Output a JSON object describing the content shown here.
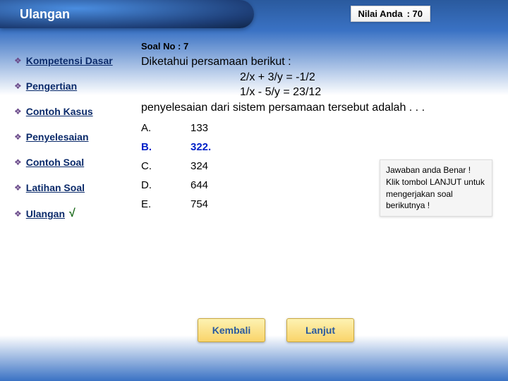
{
  "header": {
    "title": "Ulangan",
    "score_label": "Nilai Anda",
    "score_value": ": 70"
  },
  "sidebar": {
    "items": [
      {
        "label": "Kompetensi Dasar",
        "active": false
      },
      {
        "label": "Pengertian",
        "active": false
      },
      {
        "label": "Contoh Kasus",
        "active": false
      },
      {
        "label": "Penyelesaian",
        "active": false
      },
      {
        "label": "Contoh Soal",
        "active": false
      },
      {
        "label": "Latihan Soal",
        "active": false
      },
      {
        "label": "Ulangan",
        "active": true
      }
    ]
  },
  "main": {
    "soal_no": "Soal No : 7",
    "question_line1": "Diketahui persamaan berikut :",
    "question_eq1": "2/x + 3/y = -1/2",
    "question_eq2": "1/x - 5/y  = 23/12",
    "question_line2": "penyelesaian dari sistem persamaan tersebut adalah . . .",
    "options": [
      {
        "letter": "A.",
        "text": "133",
        "selected": false
      },
      {
        "letter": "B.",
        "text": "322.",
        "selected": true
      },
      {
        "letter": "C.",
        "text": "324",
        "selected": false
      },
      {
        "letter": "D.",
        "text": "644",
        "selected": false
      },
      {
        "letter": "E.",
        "text": "754",
        "selected": false
      }
    ],
    "feedback": "Jawaban anda Benar ! Klik tombol LANJUT untuk mengerjakan soal berikutnya !"
  },
  "buttons": {
    "back": "Kembali",
    "next": "Lanjut"
  }
}
